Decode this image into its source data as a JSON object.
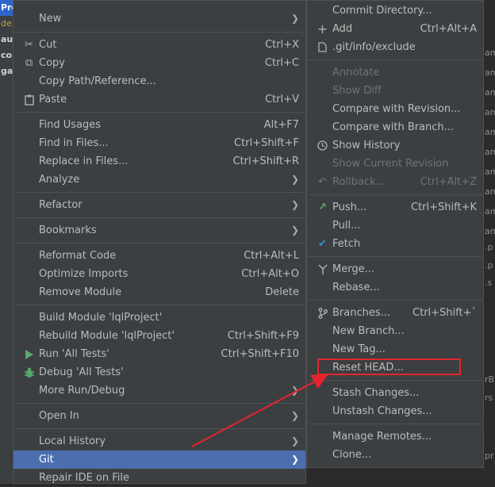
{
  "background": {
    "left_rows": [
      "Pro",
      "de",
      "aut",
      "cor",
      "gat",
      "",
      "",
      "",
      "",
      ""
    ],
    "right_snippets": [
      "am",
      "am",
      "am",
      "am",
      "am",
      "am",
      "am",
      "am",
      "am",
      "am",
      ".p",
      ".p",
      ".s",
      "rB",
      "rs",
      "pr"
    ]
  },
  "left_menu": {
    "items": [
      {
        "label": "New",
        "shortcut": "",
        "submenu": true,
        "icon": ""
      },
      {
        "label": "Cut",
        "shortcut": "Ctrl+X",
        "submenu": false,
        "icon": "scissors-icon"
      },
      {
        "label": "Copy",
        "shortcut": "Ctrl+C",
        "submenu": false,
        "icon": "copy-icon"
      },
      {
        "label": "Copy Path/Reference...",
        "shortcut": "",
        "submenu": false,
        "icon": ""
      },
      {
        "label": "Paste",
        "shortcut": "Ctrl+V",
        "submenu": false,
        "icon": "clipboard-icon"
      },
      {
        "label": "Find Usages",
        "shortcut": "Alt+F7",
        "submenu": false,
        "icon": ""
      },
      {
        "label": "Find in Files...",
        "shortcut": "Ctrl+Shift+F",
        "submenu": false,
        "icon": ""
      },
      {
        "label": "Replace in Files...",
        "shortcut": "Ctrl+Shift+R",
        "submenu": false,
        "icon": ""
      },
      {
        "label": "Analyze",
        "shortcut": "",
        "submenu": true,
        "icon": ""
      },
      {
        "label": "Refactor",
        "shortcut": "",
        "submenu": true,
        "icon": ""
      },
      {
        "label": "Bookmarks",
        "shortcut": "",
        "submenu": true,
        "icon": ""
      },
      {
        "label": "Reformat Code",
        "shortcut": "Ctrl+Alt+L",
        "submenu": false,
        "icon": ""
      },
      {
        "label": "Optimize Imports",
        "shortcut": "Ctrl+Alt+O",
        "submenu": false,
        "icon": ""
      },
      {
        "label": "Remove Module",
        "shortcut": "Delete",
        "submenu": false,
        "icon": ""
      },
      {
        "label": "Build Module 'lqlProject'",
        "shortcut": "",
        "submenu": false,
        "icon": ""
      },
      {
        "label": "Rebuild Module 'lqlProject'",
        "shortcut": "Ctrl+Shift+F9",
        "submenu": false,
        "icon": ""
      },
      {
        "label": "Run 'All Tests'",
        "shortcut": "Ctrl+Shift+F10",
        "submenu": false,
        "icon": "run-icon"
      },
      {
        "label": "Debug 'All Tests'",
        "shortcut": "",
        "submenu": false,
        "icon": "debug-icon"
      },
      {
        "label": "More Run/Debug",
        "shortcut": "",
        "submenu": true,
        "icon": ""
      },
      {
        "label": "Open In",
        "shortcut": "",
        "submenu": true,
        "icon": ""
      },
      {
        "label": "Local History",
        "shortcut": "",
        "submenu": true,
        "icon": ""
      },
      {
        "label": "Git",
        "shortcut": "",
        "submenu": true,
        "icon": "",
        "selected": true
      },
      {
        "label": "Repair IDE on File",
        "shortcut": "",
        "submenu": false,
        "icon": ""
      }
    ]
  },
  "right_menu": {
    "items": [
      {
        "label": "Commit Directory...",
        "shortcut": "",
        "icon": "",
        "disabled": false
      },
      {
        "label": "Add",
        "shortcut": "Ctrl+Alt+A",
        "icon": "plus-icon",
        "disabled": false
      },
      {
        "label": ".git/info/exclude",
        "shortcut": "",
        "icon": "file-icon",
        "disabled": false
      },
      {
        "label": "Annotate",
        "shortcut": "",
        "icon": "",
        "disabled": true
      },
      {
        "label": "Show Diff",
        "shortcut": "",
        "icon": "",
        "disabled": true
      },
      {
        "label": "Compare with Revision...",
        "shortcut": "",
        "icon": "",
        "disabled": false
      },
      {
        "label": "Compare with Branch...",
        "shortcut": "",
        "icon": "",
        "disabled": false
      },
      {
        "label": "Show History",
        "shortcut": "",
        "icon": "clock-icon",
        "disabled": false
      },
      {
        "label": "Show Current Revision",
        "shortcut": "",
        "icon": "",
        "disabled": true
      },
      {
        "label": "Rollback...",
        "shortcut": "Ctrl+Alt+Z",
        "icon": "rollback-icon",
        "disabled": true
      },
      {
        "label": "Push...",
        "shortcut": "Ctrl+Shift+K",
        "icon": "push-icon",
        "disabled": false
      },
      {
        "label": "Pull...",
        "shortcut": "",
        "icon": "",
        "disabled": false
      },
      {
        "label": "Fetch",
        "shortcut": "",
        "icon": "fetch-icon",
        "disabled": false
      },
      {
        "label": "Merge...",
        "shortcut": "",
        "icon": "merge-icon",
        "disabled": false
      },
      {
        "label": "Rebase...",
        "shortcut": "",
        "icon": "",
        "disabled": false
      },
      {
        "label": "Branches...",
        "shortcut": "Ctrl+Shift+`",
        "icon": "branch-icon",
        "disabled": false
      },
      {
        "label": "New Branch...",
        "shortcut": "",
        "icon": "",
        "disabled": false
      },
      {
        "label": "New Tag...",
        "shortcut": "",
        "icon": "",
        "disabled": false
      },
      {
        "label": "Reset HEAD...",
        "shortcut": "",
        "icon": "",
        "disabled": false
      },
      {
        "label": "Stash Changes...",
        "shortcut": "",
        "icon": "",
        "disabled": false
      },
      {
        "label": "Unstash Changes...",
        "shortcut": "",
        "icon": "",
        "disabled": false
      },
      {
        "label": "Manage Remotes...",
        "shortcut": "",
        "icon": "",
        "disabled": false
      },
      {
        "label": "Clone...",
        "shortcut": "",
        "icon": "",
        "disabled": false
      }
    ]
  },
  "colors": {
    "menu_bg": "#3c3f41",
    "selected_bg": "#4b6eaf",
    "annotation_red": "#e5252d"
  }
}
